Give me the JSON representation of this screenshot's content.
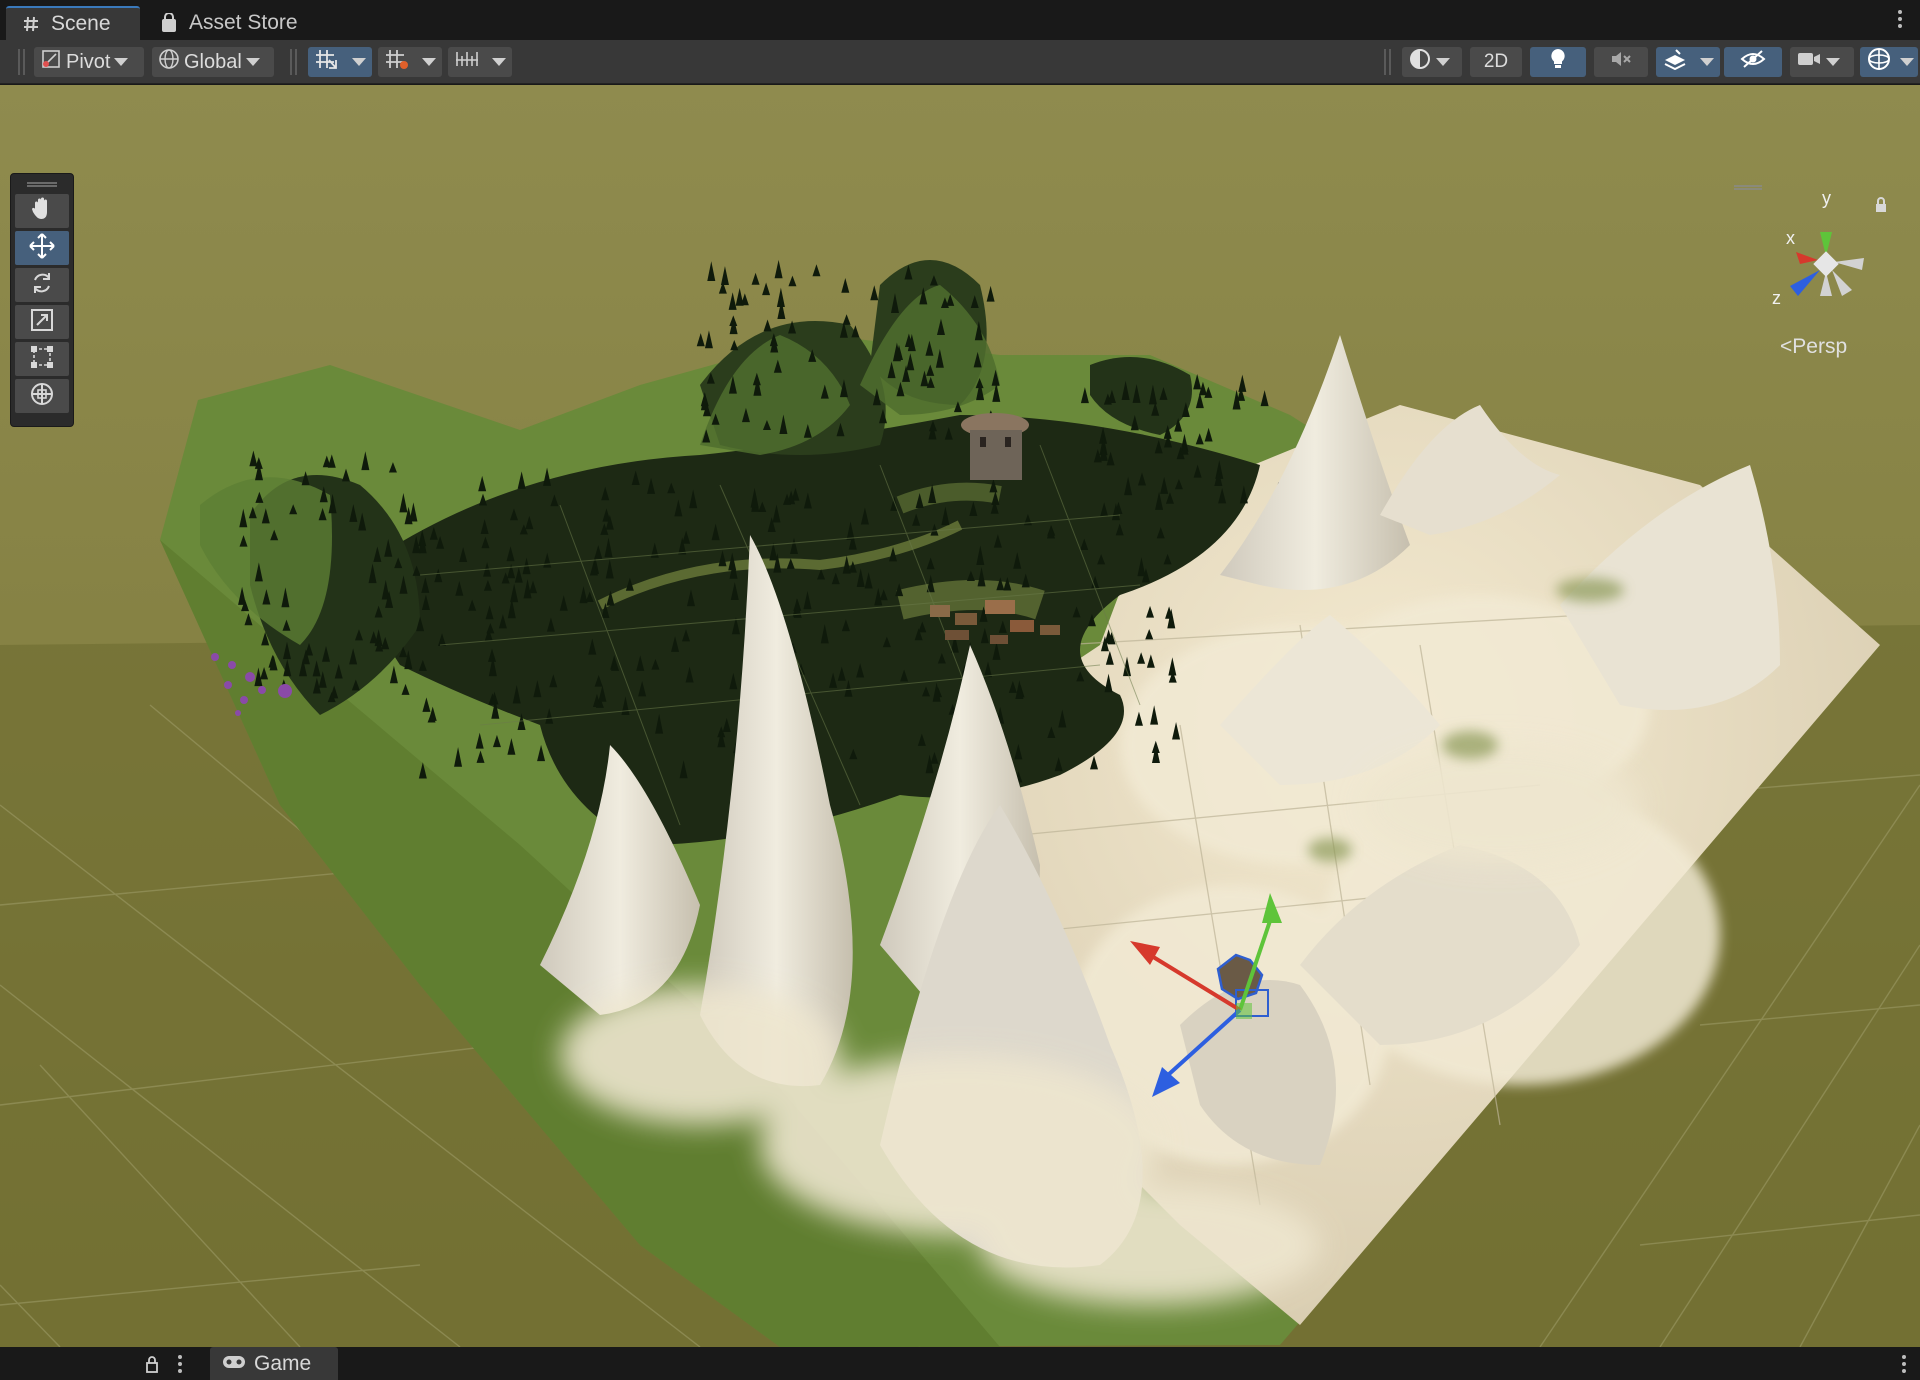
{
  "tabs": {
    "scene": "Scene",
    "asset_store": "Asset Store",
    "game": "Game"
  },
  "toolbar": {
    "pivot": "Pivot",
    "global": "Global",
    "mode_2d": "2D",
    "icons": [
      "snap-grid-icon",
      "grid-icon",
      "increment-snap-icon",
      "shading-mode-icon",
      "lighting-icon",
      "audio-mute-icon",
      "effects-icon",
      "scene-visibility-icon",
      "camera-icon",
      "gizmos-icon"
    ]
  },
  "tools": [
    "view-tool",
    "move-tool",
    "rotate-tool",
    "scale-tool",
    "rect-tool",
    "transform-tool"
  ],
  "active_tool": "move-tool",
  "gizmo": {
    "x_label": "x",
    "y_label": "y",
    "z_label": "z",
    "projection": "Persp"
  },
  "colors": {
    "accent": "#3a79bb",
    "active_button": "#46607c",
    "panel": "#383838",
    "sky": "#8e8a4c",
    "ground": "#6b6a32",
    "snow": "#ece2c7",
    "forest": "#1d2914",
    "axis_x": "#d6392c",
    "axis_y": "#5ec43a",
    "axis_z": "#2d5fe0"
  }
}
